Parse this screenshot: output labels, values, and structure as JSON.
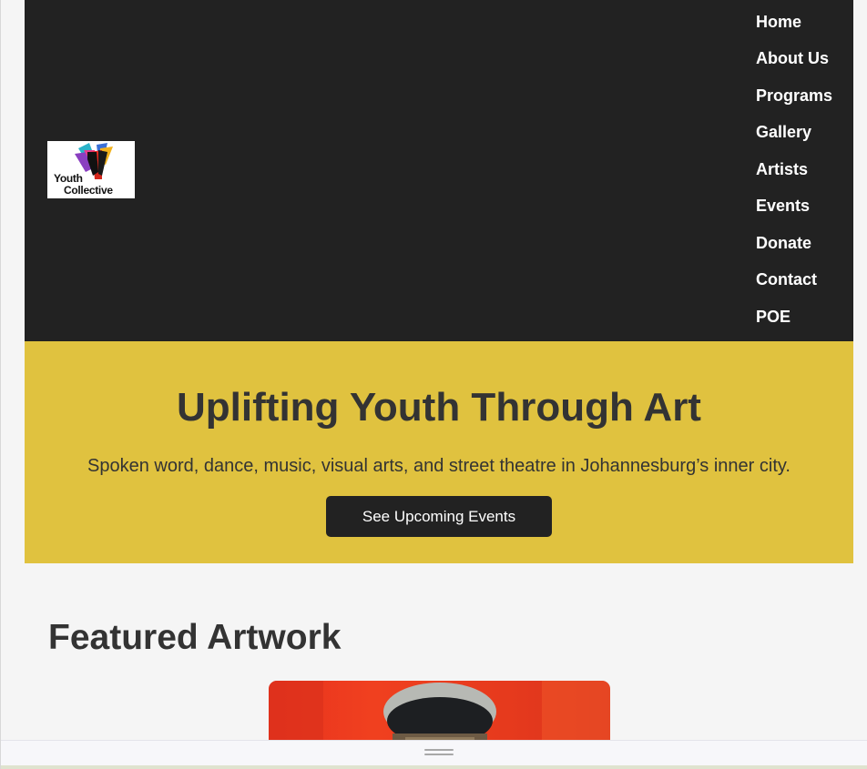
{
  "header": {
    "logo": {
      "line1": "Youth",
      "line2": "Collective"
    },
    "nav": [
      {
        "label": "Home"
      },
      {
        "label": "About Us"
      },
      {
        "label": "Programs"
      },
      {
        "label": "Gallery"
      },
      {
        "label": "Artists"
      },
      {
        "label": "Events"
      },
      {
        "label": "Donate"
      },
      {
        "label": "Contact"
      },
      {
        "label": "POE"
      }
    ]
  },
  "hero": {
    "title": "Uplifting Youth Through Art",
    "subtitle": "Spoken word, dance, music, visual arts, and street theatre in Johannesburg’s inner city.",
    "cta_label": "See Upcoming Events"
  },
  "featured": {
    "title": "Featured Artwork"
  },
  "colors": {
    "header_bg": "#222222",
    "hero_bg": "#e0c23f",
    "text_dark": "#333333",
    "page_bg": "#f5f5f5"
  },
  "icons": {
    "drag": "drag-handle-icon"
  }
}
